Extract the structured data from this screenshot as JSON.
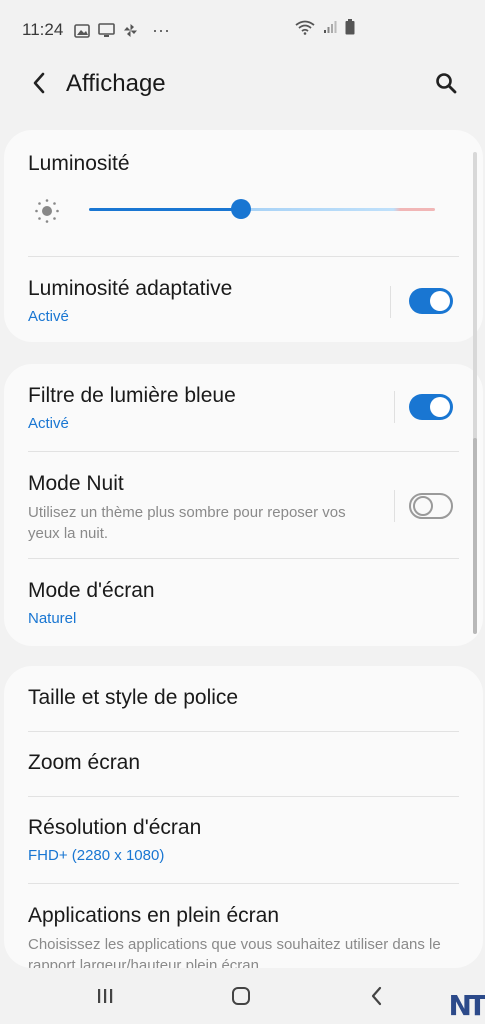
{
  "status_bar": {
    "time": "11:24",
    "more": "···"
  },
  "header": {
    "title": "Affichage"
  },
  "brightness": {
    "title": "Luminosité",
    "level": 0.44
  },
  "adaptive_brightness": {
    "title": "Luminosité adaptative",
    "status": "Activé",
    "enabled": true
  },
  "blue_light_filter": {
    "title": "Filtre de lumière bleue",
    "status": "Activé",
    "enabled": true
  },
  "night_mode": {
    "title": "Mode Nuit",
    "description": "Utilisez un thème plus sombre pour reposer vos yeux la nuit.",
    "enabled": false
  },
  "screen_mode": {
    "title": "Mode d'écran",
    "value": "Naturel"
  },
  "font_size_style": {
    "title": "Taille et style de police"
  },
  "screen_zoom": {
    "title": "Zoom écran"
  },
  "screen_resolution": {
    "title": "Résolution d'écran",
    "value": "FHD+ (2280 x 1080)"
  },
  "fullscreen_apps": {
    "title": "Applications en plein écran",
    "description": "Choisissez les applications que vous souhaitez utiliser dans le rapport largeur/hauteur plein écran."
  },
  "watermark": {
    "text": "NT"
  },
  "colors": {
    "accent": "#1976d2",
    "background": "#f2f2f2",
    "card": "#fafafa"
  }
}
